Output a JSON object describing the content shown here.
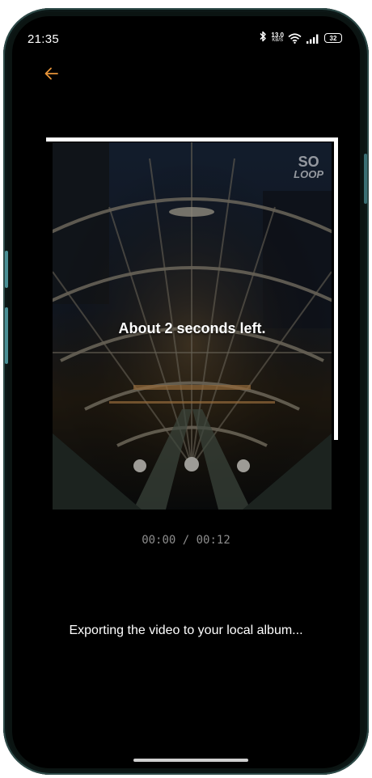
{
  "status_bar": {
    "time": "21:35",
    "bluetooth_icon": "bluetooth-icon",
    "network_speed_value": "13.0",
    "network_speed_unit": "KB/S",
    "wifi_icon": "wifi-icon",
    "signal_icon": "signal-icon",
    "battery_level": "32"
  },
  "header": {
    "back_icon": "arrow-left-icon",
    "back_color": "#e8953a"
  },
  "preview": {
    "watermark_top": "SO",
    "watermark_bottom": "LOOP",
    "progress_text": "About 2 seconds left."
  },
  "playback": {
    "time": "00:00 / 00:12"
  },
  "footer": {
    "export_message": "Exporting the video to your local album..."
  }
}
